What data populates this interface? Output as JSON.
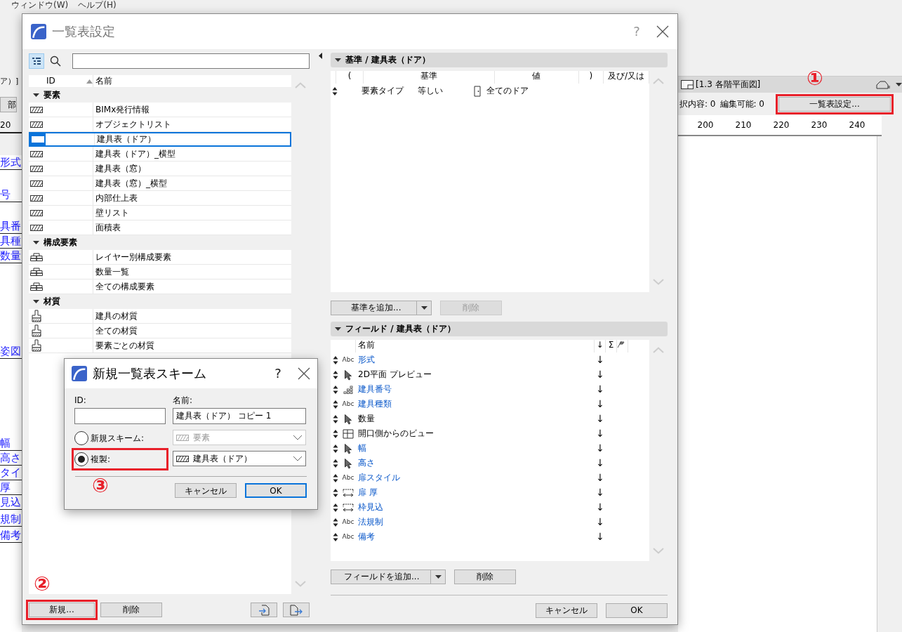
{
  "menu": [
    "ウィンドウ(W)",
    "ヘルプ(H)"
  ],
  "left_strip": {
    "tab": "ア）]",
    "button": "部",
    "ruler": "20",
    "links": [
      "形式",
      "号",
      "具番",
      "具種",
      "数量",
      "姿図",
      "幅",
      "高さ",
      "タイ",
      "厚",
      "見込",
      "規制",
      "備考"
    ]
  },
  "view_panel": {
    "tab": "[1.3 各階平面図]",
    "selection": "択内容: 0",
    "editable": "編集可能: 0",
    "button": "一覧表設定...",
    "ruler": [
      "200",
      "210",
      "220",
      "230",
      "240"
    ]
  },
  "dialog": {
    "title": "一覧表設定",
    "help": "?",
    "columns": [
      "ID",
      "名前"
    ],
    "groups": [
      {
        "label": "要素",
        "expanded": true,
        "kind": "table",
        "items": [
          {
            "name": "BIMx発行情報",
            "selected": false
          },
          {
            "name": "オブジェクトリスト",
            "selected": false
          },
          {
            "name": "建具表（ドア）",
            "selected": true
          },
          {
            "name": "建具表（ドア）_横型",
            "selected": false
          },
          {
            "name": "建具表（窓）",
            "selected": false
          },
          {
            "name": "建具表（窓）_横型",
            "selected": false
          },
          {
            "name": "内部仕上表",
            "selected": false
          },
          {
            "name": "壁リスト",
            "selected": false
          },
          {
            "name": "面積表",
            "selected": false
          }
        ]
      },
      {
        "label": "構成要素",
        "expanded": true,
        "kind": "component",
        "items": [
          {
            "name": "レイヤー別構成要素",
            "selected": false
          },
          {
            "name": "数量一覧",
            "selected": false
          },
          {
            "name": "全ての構成要素",
            "selected": false
          }
        ]
      },
      {
        "label": "材質",
        "expanded": true,
        "kind": "material",
        "items": [
          {
            "name": "建具の材質",
            "selected": false
          },
          {
            "name": "全ての材質",
            "selected": false
          },
          {
            "name": "要素ごとの材質",
            "selected": false
          }
        ]
      }
    ],
    "new_button": "新規...",
    "delete_button": "削除",
    "criteria": {
      "title": "基準 / 建具表（ドア）",
      "columns": [
        "(",
        "基準",
        "値",
        ")",
        "及び/又は"
      ],
      "rows": [
        {
          "criterion": "要素タイプ",
          "operator": "等しい",
          "value": "全てのドア"
        }
      ],
      "add_button": "基準を追加...",
      "delete_button": {
        "label": "削除",
        "disabled": true
      }
    },
    "fields": {
      "title": "フィールド / 建具表（ドア）",
      "name_column": "名前",
      "sort_column": "↓",
      "sum_column": "Σ",
      "rows": [
        {
          "kind": "text",
          "icon_label": "Abc",
          "name": "形式",
          "linked": true,
          "sort": "↓"
        },
        {
          "kind": "pointer",
          "name": "2D平面 プレビュー",
          "linked": false,
          "sort": "↓"
        },
        {
          "kind": "number",
          "name": "建具番号",
          "linked": true,
          "sort": "↓"
        },
        {
          "kind": "text",
          "icon_label": "Abc",
          "name": "建具種類",
          "linked": true,
          "sort": "↓"
        },
        {
          "kind": "pointer",
          "name": "数量",
          "linked": false,
          "sort": "↓"
        },
        {
          "kind": "view",
          "name": "開口側からのビュー",
          "linked": false,
          "sort": "↓"
        },
        {
          "kind": "pointer",
          "name": "幅",
          "linked": true,
          "sort": "↓"
        },
        {
          "kind": "pointer",
          "name": "高さ",
          "linked": true,
          "sort": "↓"
        },
        {
          "kind": "text",
          "icon_label": "Abc",
          "name": "扉スタイル",
          "linked": true,
          "sort": "↓"
        },
        {
          "kind": "dimension",
          "name": "扉 厚",
          "linked": true,
          "sort": "↓"
        },
        {
          "kind": "dimension",
          "name": "枠見込",
          "linked": true,
          "sort": "↓"
        },
        {
          "kind": "text",
          "icon_label": "Abc",
          "name": "法規制",
          "linked": true,
          "sort": "↓"
        },
        {
          "kind": "text",
          "icon_label": "Abc",
          "name": "備考",
          "linked": true,
          "sort": "↓"
        }
      ],
      "add_button": "フィールドを追加...",
      "delete_button": "削除"
    },
    "footer": [
      {
        "label": "キャンセル",
        "default": false
      },
      {
        "label": "OK",
        "default": false
      }
    ]
  },
  "subdialog": {
    "title": "新規一覧表スキーム",
    "help": "?",
    "id_label": "ID:",
    "name_label": "名前:",
    "name_value": "建具表（ドア） コピー 1",
    "options": [
      {
        "label": "新規スキーム:",
        "selected": false,
        "value": "要素",
        "disabled": true
      },
      {
        "label": "複製:",
        "selected": true,
        "value": "建具表（ドア）",
        "disabled": false
      }
    ],
    "buttons": [
      {
        "label": "キャンセル",
        "default": false
      },
      {
        "label": "OK",
        "default": true
      }
    ]
  },
  "annotations": [
    {
      "number": "①"
    },
    {
      "number": "②"
    },
    {
      "number": "③"
    }
  ]
}
